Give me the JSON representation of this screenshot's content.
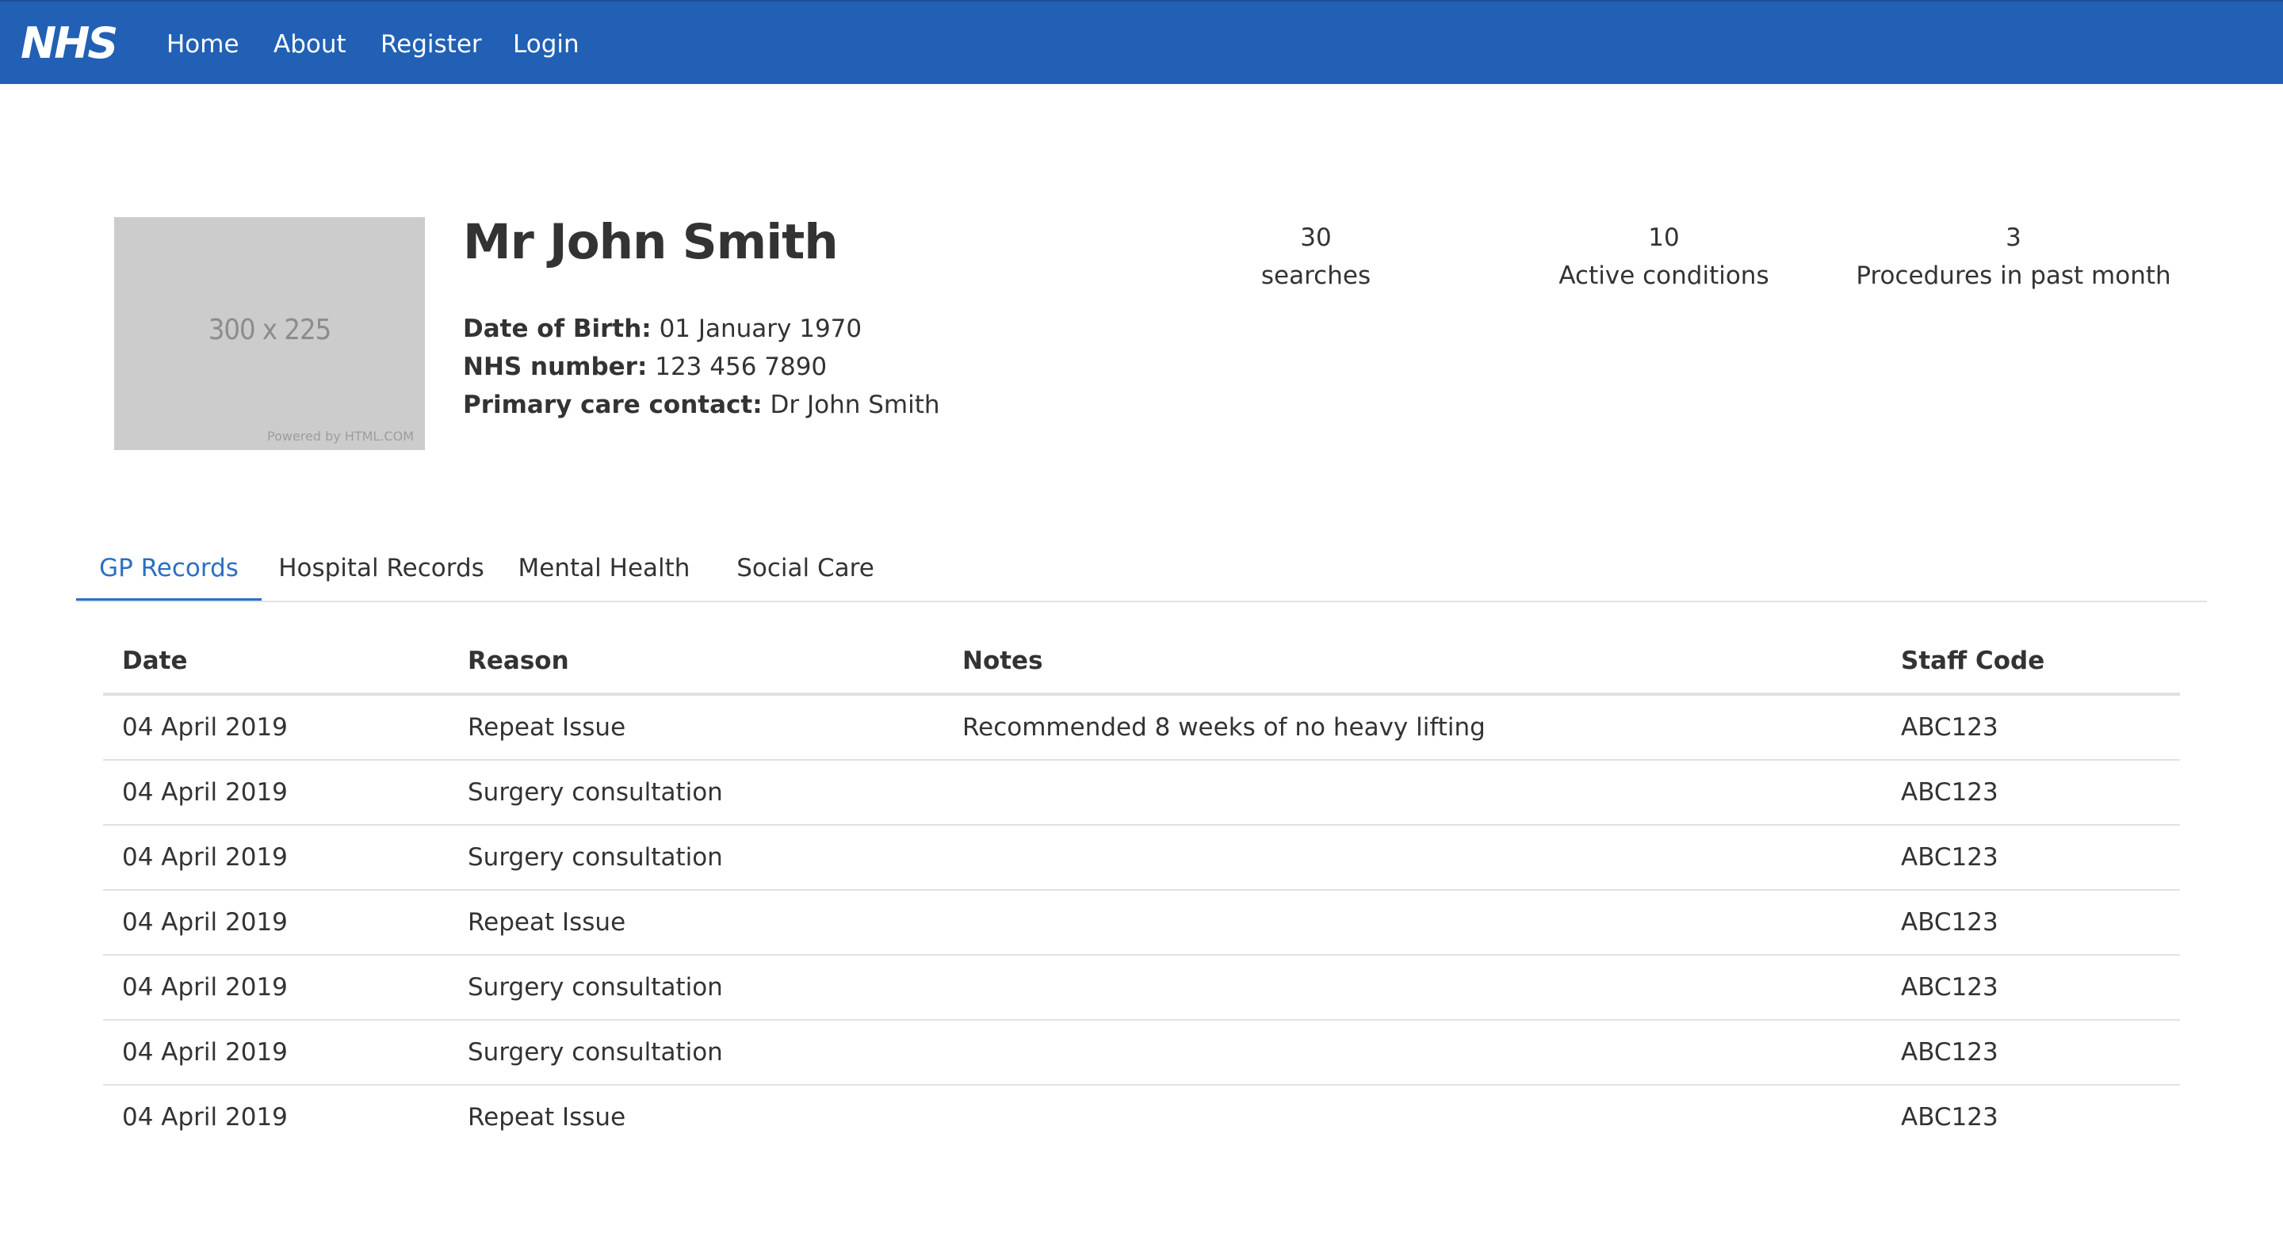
{
  "nav": {
    "logo": "NHS",
    "links": [
      "Home",
      "About",
      "Register",
      "Login"
    ]
  },
  "colors": {
    "brand": "#2160b4",
    "active_tab": "#2c6fc4"
  },
  "profile": {
    "image_placeholder": "300 x 225",
    "image_credit": "Powered by HTML.COM",
    "name": "Mr John Smith",
    "dob_label": "Date of Birth:",
    "dob": "01 January 1970",
    "nhs_label": "NHS number:",
    "nhs_number": "123 456 7890",
    "contact_label": "Primary care contact:",
    "contact": "Dr John Smith"
  },
  "stats": [
    {
      "value": "30",
      "label": "searches"
    },
    {
      "value": "10",
      "label": "Active conditions"
    },
    {
      "value": "3",
      "label": "Procedures in past month"
    }
  ],
  "tabs": [
    {
      "label": "GP Records",
      "active": true
    },
    {
      "label": "Hospital Records",
      "active": false
    },
    {
      "label": "Mental Health",
      "active": false
    },
    {
      "label": "Social Care",
      "active": false
    }
  ],
  "table": {
    "columns": [
      "Date",
      "Reason",
      "Notes",
      "Staff Code"
    ],
    "rows": [
      [
        "04 April 2019",
        "Repeat Issue",
        "Recommended 8 weeks of no heavy lifting",
        "ABC123"
      ],
      [
        "04 April 2019",
        "Surgery consultation",
        "",
        "ABC123"
      ],
      [
        "04 April 2019",
        "Surgery consultation",
        "",
        "ABC123"
      ],
      [
        "04 April 2019",
        "Repeat Issue",
        "",
        "ABC123"
      ],
      [
        "04 April 2019",
        "Surgery consultation",
        "",
        "ABC123"
      ],
      [
        "04 April 2019",
        "Surgery consultation",
        "",
        "ABC123"
      ],
      [
        "04 April 2019",
        "Repeat Issue",
        "",
        "ABC123"
      ]
    ]
  }
}
